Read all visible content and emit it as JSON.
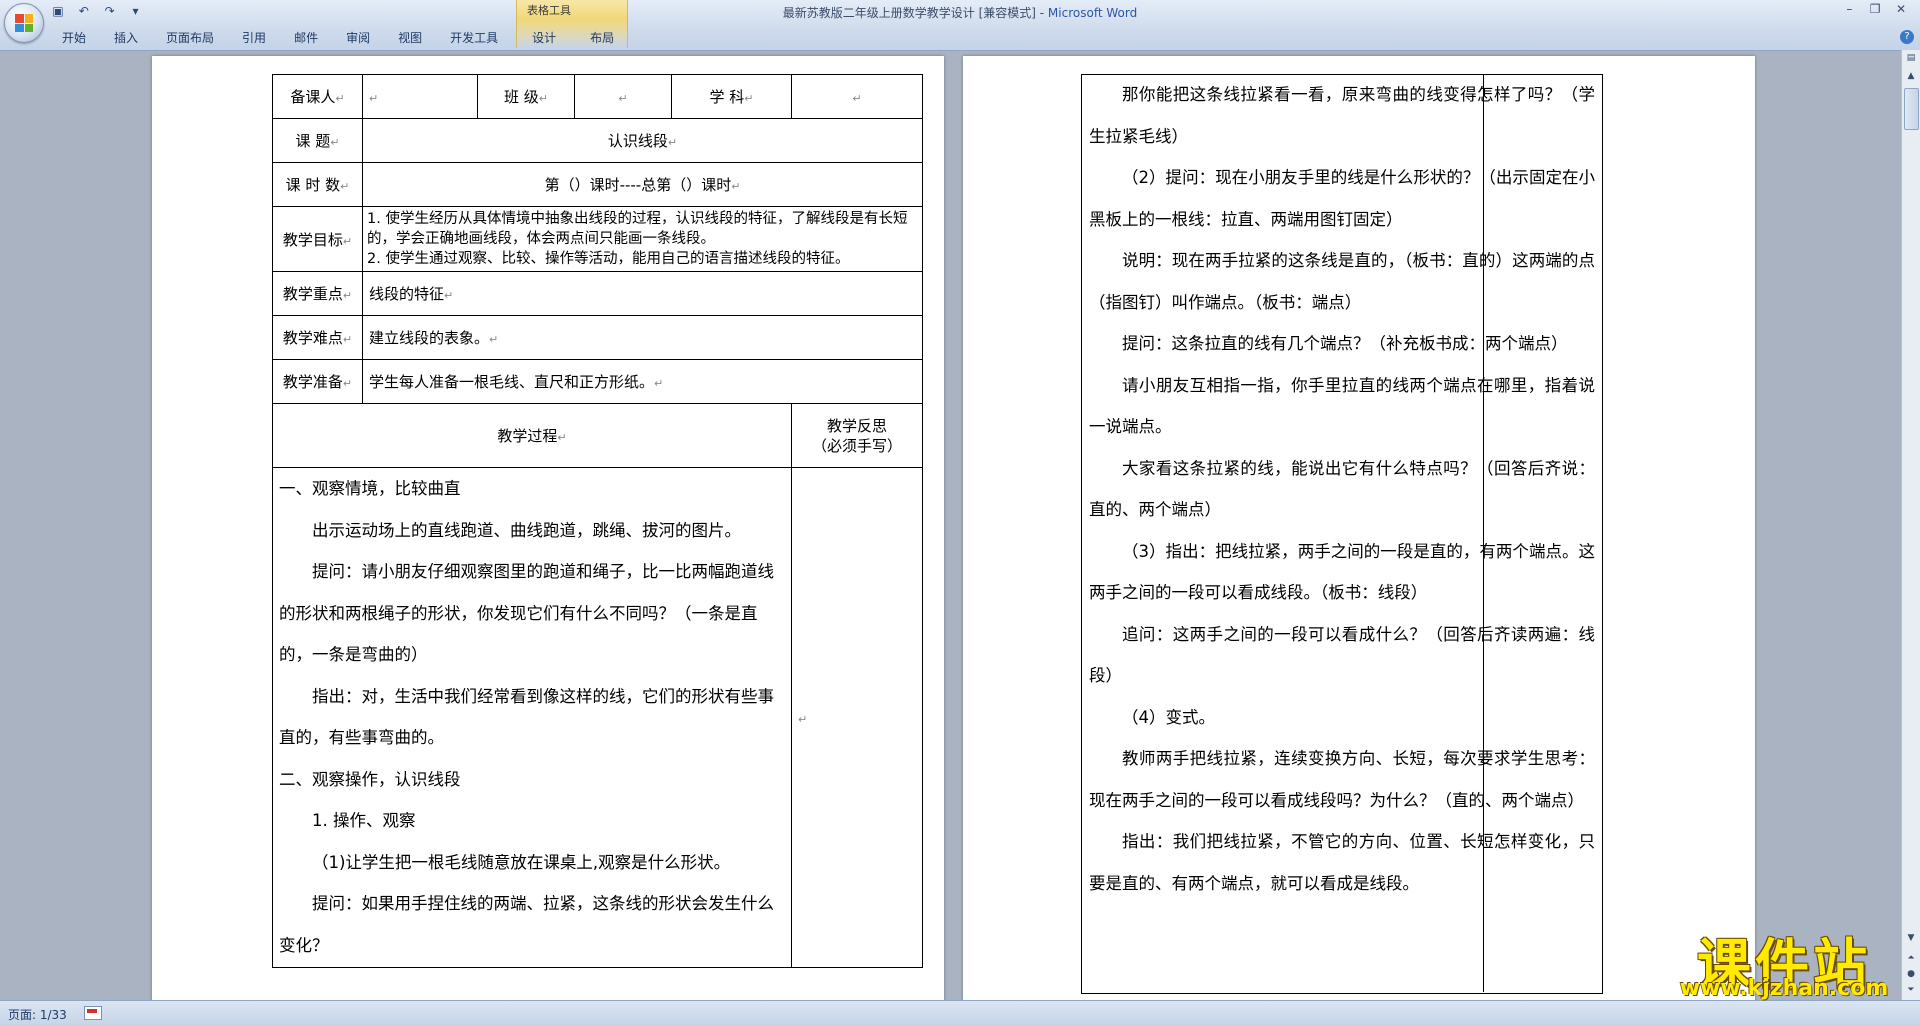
{
  "window": {
    "title_doc": "最新苏教版二年级上册数学教学设计 [兼容模式] - ",
    "title_app": "Microsoft Word",
    "controls": [
      "–",
      "❐",
      "✕"
    ]
  },
  "ribbon": {
    "tool_group": "表格工具",
    "tabs": [
      "开始",
      "插入",
      "页面布局",
      "引用",
      "邮件",
      "审阅",
      "视图",
      "开发工具",
      "设计",
      "布局"
    ]
  },
  "status": {
    "page_count": "页面: 1/33"
  },
  "lesson": {
    "preparer_label": "备课人",
    "class_label": "班  级",
    "subject_label": "学  科",
    "topic_label": "课    题",
    "topic": "认识线段",
    "hours_label": "课 时 数",
    "hours": "第（）课时----总第（）课时",
    "goals_label": "教学目标",
    "goals": [
      "1. 使学生经历从具体情境中抽象出线段的过程，认识线段的特征，了解线段是有长短的，学会正确地画线段，体会两点间只能画一条线段。",
      "2. 使学生通过观察、比较、操作等活动，能用自己的语言描述线段的特征。"
    ],
    "focus_label": "教学重点",
    "focus": "线段的特征",
    "difficulty_label": "教学难点",
    "difficulty": "建立线段的表象。",
    "prep_label": "教学准备",
    "prep": "学生每人准备一根毛线、直尺和正方形纸。",
    "process_label": "教学过程",
    "reflect_label_1": "教学反思",
    "reflect_label_2": "（必须手写）",
    "process": [
      "一、观察情境，比较曲直",
      "出示运动场上的直线跑道、曲线跑道，跳绳、拔河的图片。",
      "提问：请小朋友仔细观察图里的跑道和绳子，比一比两幅跑道线的形状和两根绳子的形状，你发现它们有什么不同吗？（一条是直的，一条是弯曲的）",
      "指出：对，生活中我们经常看到像这样的线，它们的形状有些事直的，有些事弯曲的。",
      "二、观察操作，认识线段",
      "1. 操作、观察",
      "（1)让学生把一根毛线随意放在课桌上,观察是什么形状。",
      "提问：如果用手捏住线的两端、拉紧，这条线的形状会发生什么变化？"
    ]
  },
  "continued": [
    "那你能把这条线拉紧看一看，原来弯曲的线变得怎样了吗？（学生拉紧毛线）",
    "（2）提问：现在小朋友手里的线是什么形状的？（出示固定在小黑板上的一根线：拉直、两端用图钉固定）",
    "说明：现在两手拉紧的这条线是直的，（板书：直的）这两端的点（指图钉）叫作端点。（板书：端点）",
    "提问：这条拉直的线有几个端点？（补充板书成：两个端点）",
    "请小朋友互相指一指，你手里拉直的线两个端点在哪里，指着说一说端点。",
    "大家看这条拉紧的线，能说出它有什么特点吗？（回答后齐说：直的、两个端点）",
    "（3）指出：把线拉紧，两手之间的一段是直的，有两个端点。这两手之间的一段可以看成线段。（板书：线段）",
    "追问：这两手之间的一段可以看成什么？（回答后齐读两遍：线段）",
    "（4）变式。",
    "教师两手把线拉紧，连续变换方向、长短，每次要求学生思考：现在两手之间的一段可以看成线段吗？为什么？（直的、两个端点）",
    "指出：我们把线拉紧，不管它的方向、位置、长短怎样变化，只要是直的、有两个端点，就可以看成是线段。"
  ],
  "watermark": {
    "name": "课件站",
    "url": "www.kjzhan.com"
  }
}
